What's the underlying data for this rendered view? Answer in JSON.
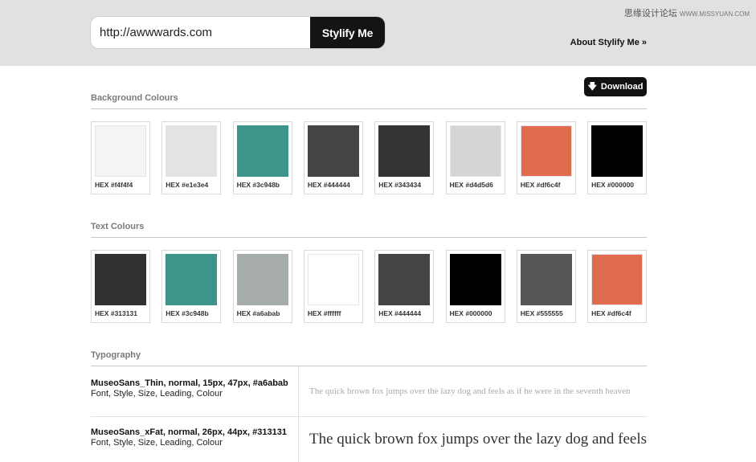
{
  "header": {
    "url_value": "http://awwwards.com",
    "submit_label": "Stylify Me",
    "about_label": "About Stylify Me »",
    "watermark": "思缘设计论坛",
    "watermark_url": "WWW.MISSYUAN.COM"
  },
  "download": {
    "label": "Download",
    "icon": "download-arrow-icon"
  },
  "background_colours": {
    "title": "Background Colours",
    "items": [
      {
        "label": "HEX #f4f4f4",
        "color": "#f4f4f4"
      },
      {
        "label": "HEX #e1e3e4",
        "color": "#e1e3e4"
      },
      {
        "label": "HEX #3c948b",
        "color": "#3c948b"
      },
      {
        "label": "HEX #444444",
        "color": "#444444"
      },
      {
        "label": "HEX #343434",
        "color": "#343434"
      },
      {
        "label": "HEX #d4d5d6",
        "color": "#d4d5d6"
      },
      {
        "label": "HEX #df6c4f",
        "color": "#df6c4f"
      },
      {
        "label": "HEX #000000",
        "color": "#000000"
      }
    ]
  },
  "text_colours": {
    "title": "Text Colours",
    "items": [
      {
        "label": "HEX #313131",
        "color": "#313131"
      },
      {
        "label": "HEX #3c948b",
        "color": "#3c948b"
      },
      {
        "label": "HEX #a6abab",
        "color": "#a6abab"
      },
      {
        "label": "HEX #ffffff",
        "color": "#ffffff"
      },
      {
        "label": "HEX #444444",
        "color": "#444444"
      },
      {
        "label": "HEX #000000",
        "color": "#000000"
      },
      {
        "label": "HEX #555555",
        "color": "#555555"
      },
      {
        "label": "HEX #df6c4f",
        "color": "#df6c4f"
      }
    ]
  },
  "typography": {
    "title": "Typography",
    "rows": [
      {
        "spec": "MuseoSans_Thin, normal, 15px, 47px, #a6abab",
        "desc": "Font, Style, Size, Leading, Colour",
        "sample": "The quick brown fox jumps over the lazy dog and feels as if he were in the seventh heaven",
        "color": "#a6abab"
      },
      {
        "spec": "MuseoSans_xFat, normal, 26px, 44px, #313131",
        "desc": "Font, Style, Size, Leading, Colour",
        "sample": "The quick brown fox jumps over the lazy dog and feels as if he were in the seventh heaven",
        "color": "#313131"
      }
    ]
  }
}
